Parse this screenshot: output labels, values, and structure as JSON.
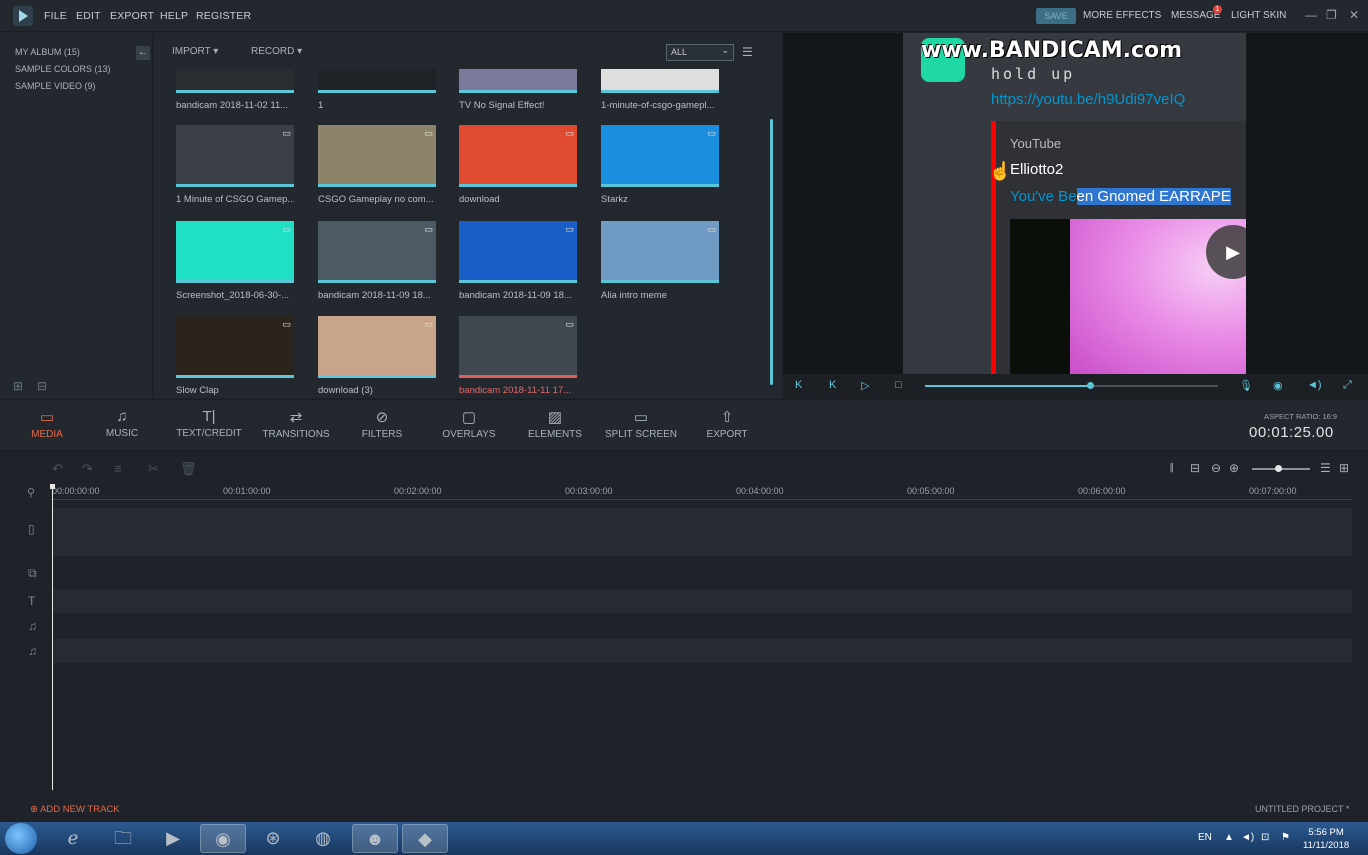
{
  "menu": [
    "FILE",
    "EDIT",
    "EXPORT",
    "HELP",
    "REGISTER"
  ],
  "topbar": {
    "save": "SAVE",
    "more_effects": "MORE EFFECTS",
    "message": "MESSAGE",
    "message_badge": "1",
    "light_skin": "LIGHT SKIN",
    "min": "—",
    "max": "❐",
    "close": "✕"
  },
  "sidebar": {
    "collapse": "←",
    "albums": [
      {
        "label": "MY ALBUM (15)",
        "active": true
      },
      {
        "label": "SAMPLE COLORS (13)",
        "active": false
      },
      {
        "label": "SAMPLE VIDEO (9)",
        "active": false
      }
    ]
  },
  "media": {
    "import": "IMPORT ▾",
    "record": "RECORD ▾",
    "filter_value": "ALL",
    "filter_arrow": "⌄",
    "items": [
      {
        "label": "bandicam 2018-11-02 11...",
        "bg": "#2a2e33"
      },
      {
        "label": "1",
        "bg": "#1f2328"
      },
      {
        "label": "TV No Signal Effect!",
        "bg": "#7a7a9c"
      },
      {
        "label": "1-minute-of-csgo-gamepl...",
        "bg": "#dedede"
      },
      {
        "label": "1 Minute of CSGO Gamep...",
        "bg": "#3b3f46"
      },
      {
        "label": "CSGO Gameplay no com...",
        "bg": "#8b8468"
      },
      {
        "label": "download",
        "bg": "#e04a2f"
      },
      {
        "label": "Starkz",
        "bg": "#1a8fe0"
      },
      {
        "label": "Screenshot_2018-06-30-...",
        "bg": "#1fe0c4"
      },
      {
        "label": "bandicam 2018-11-09 18...",
        "bg": "#4d5a64"
      },
      {
        "label": "bandicam 2018-11-09 18...",
        "bg": "#1a5fc8"
      },
      {
        "label": "Alia intro meme",
        "bg": "#6f9bc4"
      },
      {
        "label": "Slow Clap",
        "bg": "#2b241d"
      },
      {
        "label": "download (3)",
        "bg": "#c8a48b"
      },
      {
        "label": "bandicam 2018-11-11 17...",
        "bg": "#3f474f"
      }
    ]
  },
  "preview": {
    "watermark": "www.BANDICAM.com",
    "hold_up": "hold up",
    "link": "https://youtu.be/h9Udi97veIQ",
    "embed_provider": "YouTube",
    "embed_author": "Elliotto2",
    "embed_title_part1": "You've Be",
    "embed_title_part2": "en Gnomed EARRAPE",
    "progress_fraction": 0.56
  },
  "tabs": [
    {
      "label": "MEDIA",
      "icon": "▭",
      "active": true
    },
    {
      "label": "MUSIC",
      "icon": "♫",
      "active": false
    },
    {
      "label": "TEXT/CREDIT",
      "icon": "T|",
      "active": false
    },
    {
      "label": "TRANSITIONS",
      "icon": "⇄",
      "active": false
    },
    {
      "label": "FILTERS",
      "icon": "⊘",
      "active": false
    },
    {
      "label": "OVERLAYS",
      "icon": "▢",
      "active": false
    },
    {
      "label": "ELEMENTS",
      "icon": "▨",
      "active": false
    },
    {
      "label": "SPLIT SCREEN",
      "icon": "▭",
      "active": false
    },
    {
      "label": "EXPORT",
      "icon": "⇧",
      "active": false
    }
  ],
  "aspect_ratio": "ASPECT RATIO: 16:9",
  "duration": "00:01:25.00",
  "timeline": {
    "ticks": [
      "00:00:00:00",
      "00:01:00:00",
      "00:02:00:00",
      "00:03:00:00",
      "00:04:00:00",
      "00:05:00:00",
      "00:06:00:00",
      "00:07:00:00"
    ],
    "add_track": "ADD NEW TRACK",
    "project_name": "UNTITLED PROJECT *"
  },
  "taskbar": {
    "lang": "EN",
    "time": "5:56 PM",
    "date": "11/11/2018"
  }
}
